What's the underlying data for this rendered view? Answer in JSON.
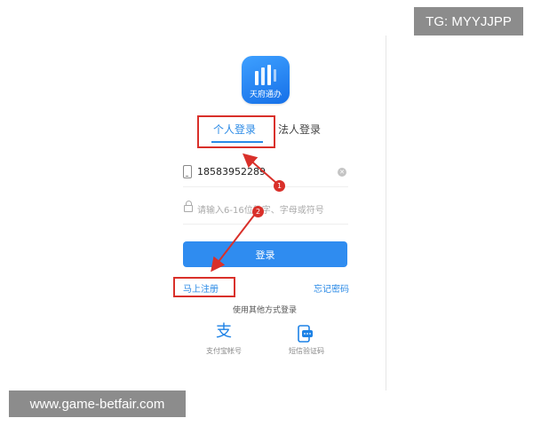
{
  "overlay": {
    "tg_badge": "TG: MYYJJPP",
    "site_badge": "www.game-betfair.com"
  },
  "app": {
    "logo_text": "天府通办"
  },
  "tabs": [
    {
      "label": "个人登录",
      "active": true
    },
    {
      "label": "法人登录",
      "active": false
    }
  ],
  "form": {
    "phone_value": "18583952289",
    "clear_icon": "clear-icon",
    "password_placeholder": "请输入6-16位数字、字母或符号",
    "login_label": "登录",
    "register_label": "马上注册",
    "forgot_label": "忘记密码"
  },
  "other_login": {
    "label": "使用其他方式登录",
    "methods": [
      {
        "label": "支付宝帐号",
        "icon": "alipay-icon"
      },
      {
        "label": "短信验证码",
        "icon": "sms-icon"
      }
    ]
  },
  "annotations": {
    "marker_1": "1",
    "marker_2": "2"
  },
  "colors": {
    "accent": "#2b8ae6",
    "button": "#2f8cf0",
    "annotation": "#d9302a"
  }
}
